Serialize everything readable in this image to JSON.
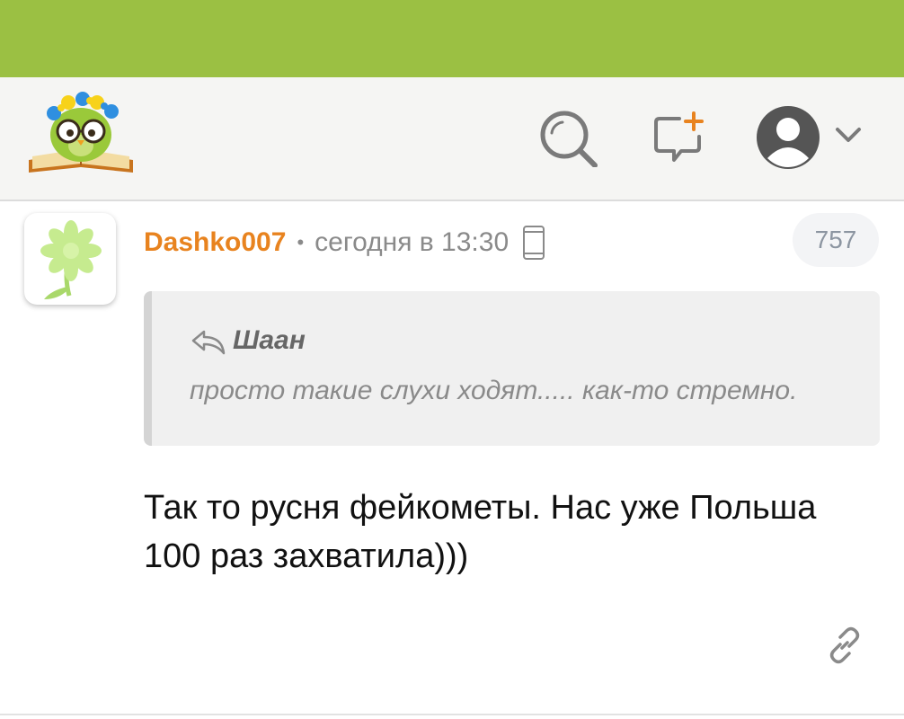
{
  "header": {
    "logo": "owl-with-book-logo",
    "icons": {
      "search": "search-icon",
      "new_post": "new-post-icon",
      "profile": "profile-avatar-icon",
      "menu": "chevron-down-icon"
    }
  },
  "colors": {
    "status_bar": "#9bc043",
    "username": "#e8831f",
    "header_bg": "#f5f5f3",
    "quote_bg": "#f0f0f0"
  },
  "comment": {
    "author": "Dashko007",
    "separator": "•",
    "time": "сегодня в 13:30",
    "device_icon": "phone-icon",
    "score": "757",
    "quote": {
      "icon": "reply-icon",
      "author": "Шаан",
      "text": "просто такие слухи ходят..... как-то стремно."
    },
    "text_line1": "Так то русня фейкометы. Нас уже Польша",
    "text_line2": "100 раз захватила)))",
    "link_icon": "link-icon"
  }
}
